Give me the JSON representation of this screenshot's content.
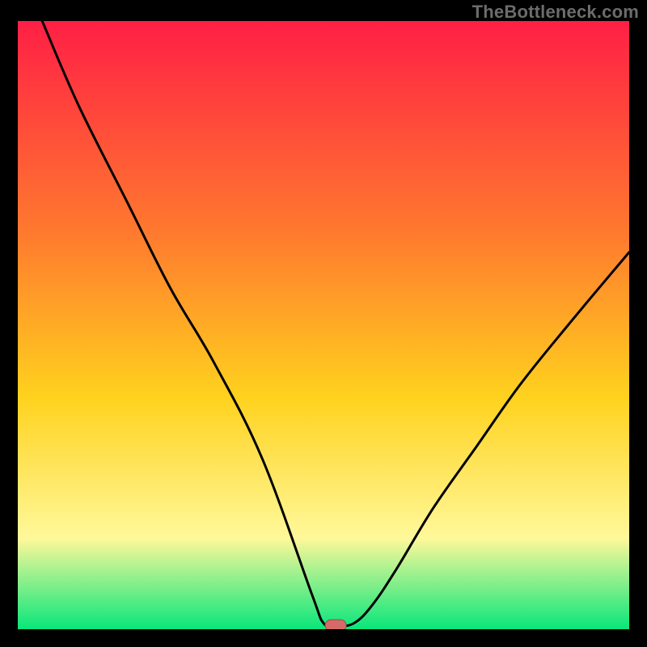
{
  "watermark": "TheBottleneck.com",
  "colors": {
    "background": "#000000",
    "gradient_top": "#ff1f45",
    "gradient_mid1": "#ff7a2e",
    "gradient_mid2": "#ffd21e",
    "gradient_mid3": "#fff89a",
    "gradient_bottom": "#09e67b",
    "curve": "#000000",
    "marker_fill": "#d46a6a",
    "marker_stroke": "#a24b4b"
  },
  "chart_data": {
    "type": "line",
    "title": "",
    "xlabel": "",
    "ylabel": "",
    "xlim": [
      0,
      100
    ],
    "ylim": [
      0,
      100
    ],
    "series": [
      {
        "name": "bottleneck-curve",
        "x": [
          4,
          10,
          18,
          25,
          32,
          40,
          48,
          50,
          52,
          55,
          58,
          62,
          68,
          75,
          82,
          90,
          100
        ],
        "y": [
          100,
          86,
          70,
          56,
          44,
          28,
          6,
          1,
          0.5,
          1,
          4,
          10,
          20,
          30,
          40,
          50,
          62
        ]
      }
    ],
    "flat_zone_x": [
      48,
      52
    ],
    "marker": {
      "x": 52,
      "y": 0.5
    }
  }
}
